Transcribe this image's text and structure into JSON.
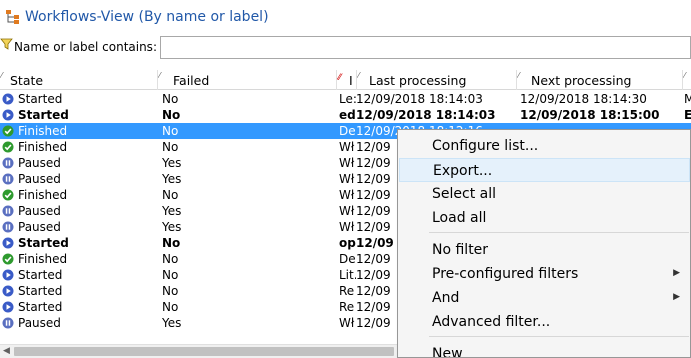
{
  "window": {
    "title": "Workflows-View (By name or label)"
  },
  "filter": {
    "label": "Name or label contains:",
    "value": "",
    "placeholder": ""
  },
  "columns": {
    "state": "State",
    "failed": "Failed",
    "label": "I",
    "last": "Last processing",
    "next": "Next processing"
  },
  "rows": [
    {
      "icon": "started",
      "state": "Started",
      "failed": "No",
      "label": "Le:",
      "last": "12/09/2018 18:14:03",
      "next": "12/09/2018 18:14:30",
      "more": "M",
      "bold": false,
      "selected": false
    },
    {
      "icon": "started",
      "state": "Started",
      "failed": "No",
      "label": "ed",
      "last": "12/09/2018 18:14:03",
      "next": "12/09/2018 18:15:00",
      "more": "E",
      "bold": true,
      "selected": false
    },
    {
      "icon": "finished",
      "state": "Finished",
      "failed": "No",
      "label": "De",
      "last": "12/09/2018 18:12:16",
      "next": "",
      "more": "",
      "bold": false,
      "selected": true
    },
    {
      "icon": "finished",
      "state": "Finished",
      "failed": "No",
      "label": "Wł",
      "last": "12/09",
      "next": "",
      "more": "",
      "bold": false,
      "selected": false
    },
    {
      "icon": "paused",
      "state": "Paused",
      "failed": "Yes",
      "label": "Wł",
      "last": "12/09",
      "next": "",
      "more": "",
      "bold": false,
      "selected": false
    },
    {
      "icon": "paused",
      "state": "Paused",
      "failed": "Yes",
      "label": "Wł",
      "last": "12/09",
      "next": "",
      "more": "",
      "bold": false,
      "selected": false
    },
    {
      "icon": "finished",
      "state": "Finished",
      "failed": "No",
      "label": "Wł",
      "last": "12/09",
      "next": "",
      "more": "",
      "bold": false,
      "selected": false
    },
    {
      "icon": "paused",
      "state": "Paused",
      "failed": "Yes",
      "label": "Wł",
      "last": "12/09",
      "next": "",
      "more": "",
      "bold": false,
      "selected": false
    },
    {
      "icon": "paused",
      "state": "Paused",
      "failed": "Yes",
      "label": "Wł",
      "last": "12/09",
      "next": "",
      "more": "",
      "bold": false,
      "selected": false
    },
    {
      "icon": "started",
      "state": "Started",
      "failed": "No",
      "label": "op",
      "last": "12/09",
      "next": "",
      "more": "",
      "bold": true,
      "selected": false
    },
    {
      "icon": "finished",
      "state": "Finished",
      "failed": "No",
      "label": "De",
      "last": "12/09",
      "next": "",
      "more": "",
      "bold": false,
      "selected": false
    },
    {
      "icon": "started",
      "state": "Started",
      "failed": "No",
      "label": "Lit.",
      "last": "12/09",
      "next": "",
      "more": "",
      "bold": false,
      "selected": false
    },
    {
      "icon": "started",
      "state": "Started",
      "failed": "No",
      "label": "Re",
      "last": "12/09",
      "next": "",
      "more": "",
      "bold": false,
      "selected": false
    },
    {
      "icon": "started",
      "state": "Started",
      "failed": "No",
      "label": "Re",
      "last": "12/09",
      "next": "",
      "more": "",
      "bold": false,
      "selected": false
    },
    {
      "icon": "paused",
      "state": "Paused",
      "failed": "Yes",
      "label": "Wł",
      "last": "12/09",
      "next": "",
      "more": "",
      "bold": false,
      "selected": false
    }
  ],
  "context_menu": {
    "items": [
      {
        "label": "Configure list...",
        "submenu": false,
        "hover": false
      },
      {
        "label": "Export...",
        "submenu": false,
        "hover": true
      },
      {
        "label": "Select all",
        "submenu": false,
        "hover": false
      },
      {
        "label": "Load all",
        "submenu": false,
        "hover": false
      },
      {
        "label": "No filter",
        "submenu": false,
        "hover": false
      },
      {
        "label": "Pre-configured filters",
        "submenu": true,
        "hover": false
      },
      {
        "label": "And",
        "submenu": true,
        "hover": false
      },
      {
        "label": "Advanced filter...",
        "submenu": false,
        "hover": false
      },
      {
        "label": "New",
        "submenu": false,
        "hover": false
      }
    ]
  },
  "icons": {
    "title": "workflow-tree-icon",
    "filter": "filter-icon",
    "started": "play-icon",
    "finished": "check-icon",
    "paused": "pause-icon"
  },
  "colors": {
    "title": "#2158a8",
    "selection": "#3399ff",
    "started": "#3a5bc7",
    "finished": "#2e9a2e",
    "paused": "#5a6fc0",
    "menu_hover": "#e5f1fb"
  }
}
